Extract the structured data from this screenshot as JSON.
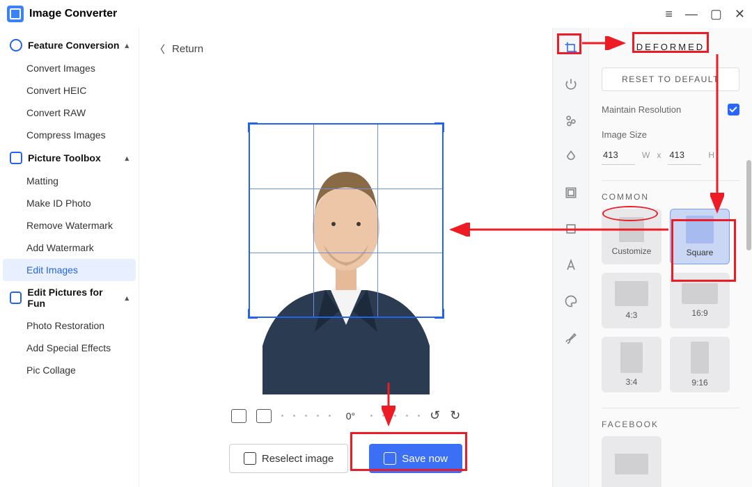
{
  "app": {
    "title": "Image Converter"
  },
  "window_controls": {
    "menu": "≡",
    "min": "—",
    "max": "▢",
    "close": "✕"
  },
  "sidebar": {
    "groups": [
      {
        "label": "Feature Conversion",
        "items": [
          "Convert Images",
          "Convert HEIC",
          "Convert RAW",
          "Compress Images"
        ]
      },
      {
        "label": "Picture Toolbox",
        "items": [
          "Matting",
          "Make ID Photo",
          "Remove Watermark",
          "Add Watermark",
          "Edit Images"
        ]
      },
      {
        "label": "Edit Pictures for Fun",
        "items": [
          "Photo Restoration",
          "Add Special Effects",
          "Pic Collage"
        ]
      }
    ],
    "active": "Edit Images"
  },
  "canvas": {
    "return_label": "Return",
    "angle": "0°",
    "reselect_label": "Reselect image",
    "save_label": "Save now"
  },
  "panel": {
    "section": "DEFORMED",
    "reset": "RESET TO DEFAULT",
    "maintain_label": "Maintain Resolution",
    "size_label": "Image Size",
    "width": "413",
    "w_unit": "W",
    "x": "x",
    "height": "413",
    "h_unit": "H",
    "common_label": "COMMON",
    "presets": [
      {
        "label": "Customize",
        "w": 36,
        "h": 36
      },
      {
        "label": "Square",
        "w": 40,
        "h": 40,
        "selected": true
      },
      {
        "label": "4:3",
        "w": 48,
        "h": 36
      },
      {
        "label": "16:9",
        "w": 52,
        "h": 30
      },
      {
        "label": "3:4",
        "w": 32,
        "h": 44
      },
      {
        "label": "9:16",
        "w": 26,
        "h": 46
      }
    ],
    "facebook_label": "FACEBOOK"
  }
}
